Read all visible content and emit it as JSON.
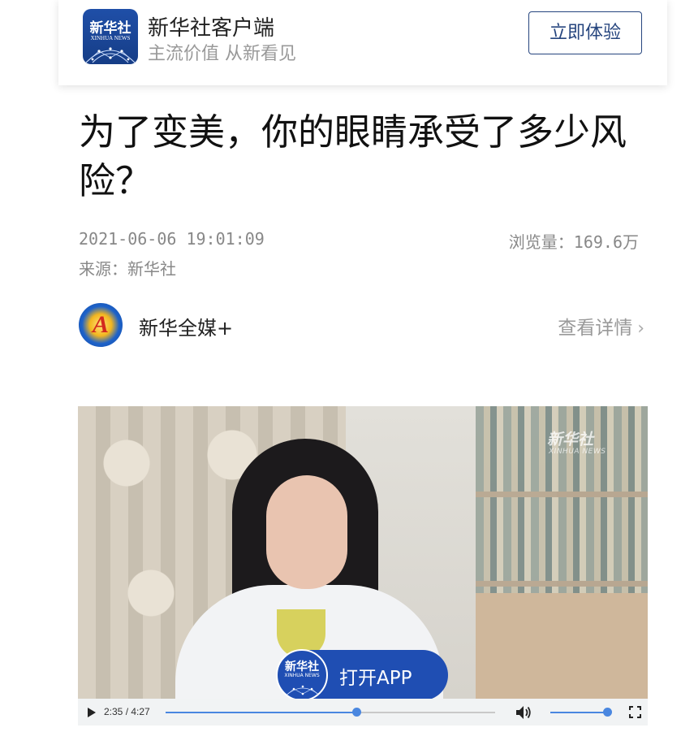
{
  "banner": {
    "logo_cn": "新华社",
    "logo_en": "XINHUA NEWS",
    "app_name": "新华社客户端",
    "slogan": "主流价值  从新看见",
    "try_button": "立即体验"
  },
  "article": {
    "title": "为了变美，你的眼睛承受了多少风险？",
    "date": "2021-06-06 19:01:09",
    "views": "浏览量：169.6万",
    "source": "来源：新华社"
  },
  "author": {
    "name": "新华全媒+",
    "details_link": "查看详情",
    "avatar_icon": "xinhua-quanmei-logo-icon"
  },
  "video": {
    "watermark_cn": "新华社",
    "watermark_en": "XINHUA NEWS",
    "open_app_logo_cn": "新华社",
    "open_app_logo_en": "XINHUA NEWS",
    "open_app_label": "打开APP",
    "time_display": "2:35 / 4:27",
    "progress_fraction": 0.58,
    "volume_fraction": 0.97,
    "accent_color": "#4a87e0"
  },
  "colors": {
    "brand_blue": "#1f4eb3",
    "button_border": "#26457e"
  }
}
